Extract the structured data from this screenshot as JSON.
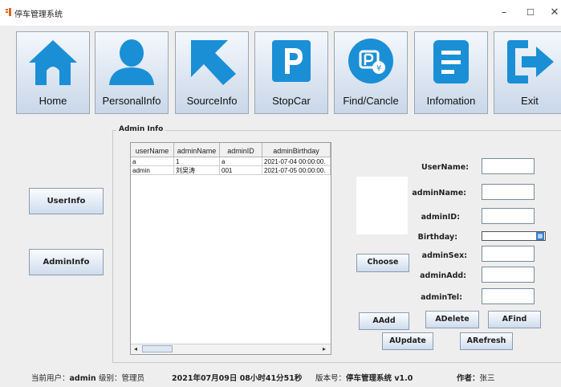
{
  "window": {
    "title": "停车管理系统",
    "minimize": "–",
    "maximize": "☐",
    "close": "✕"
  },
  "toolbar": [
    {
      "label": "Home",
      "icon": "home-icon"
    },
    {
      "label": "PersonalInfo",
      "icon": "person-icon"
    },
    {
      "label": "SourceInfo",
      "icon": "arrow-cursor-icon"
    },
    {
      "label": "StopCar",
      "icon": "parking-icon"
    },
    {
      "label": "Find/Cancle",
      "icon": "parking-pay-icon"
    },
    {
      "label": "Infomation",
      "icon": "document-icon"
    },
    {
      "label": "Exit",
      "icon": "exit-icon"
    }
  ],
  "sidebar": {
    "userinfo": "UserInfo",
    "admininfo": "AdminInfo"
  },
  "panel": {
    "title": "Admin Info"
  },
  "table": {
    "columns": [
      "userName",
      "adminName",
      "adminID",
      "adminBirthday"
    ],
    "rows": [
      [
        "a",
        "1",
        "a",
        "2021-07-04 00:00:00."
      ],
      [
        "admin",
        "刘吴涛",
        "001",
        "2021-07-05 00:00:00."
      ]
    ]
  },
  "form": {
    "username_label": "UserName:",
    "adminname_label": "adminName:",
    "adminid_label": "adminID:",
    "birthday_label": "Birthday:",
    "adminsex_label": "adminSex:",
    "adminadd_label": "adminAdd:",
    "admintel_label": "adminTel:",
    "choose": "Choose",
    "aadd": "AAdd",
    "adelete": "ADelete",
    "afind": "AFind",
    "aupdate": "AUpdate",
    "arefresh": "ARefresh"
  },
  "status": {
    "user_label": "当前用户：",
    "user": "admin",
    "level_label": "级别：",
    "level": "管理员",
    "datetime": "2021年07月09日 08小时41分51秒",
    "version_label": "版本号：",
    "version": "停车管理系统 v1.0",
    "author_label": "作者：",
    "author": "张三"
  },
  "colors": {
    "icon_blue": "#1a8fd6",
    "toolbar_gradient_top": "#f4f8fd",
    "toolbar_gradient_bottom": "#c9d7e8"
  }
}
